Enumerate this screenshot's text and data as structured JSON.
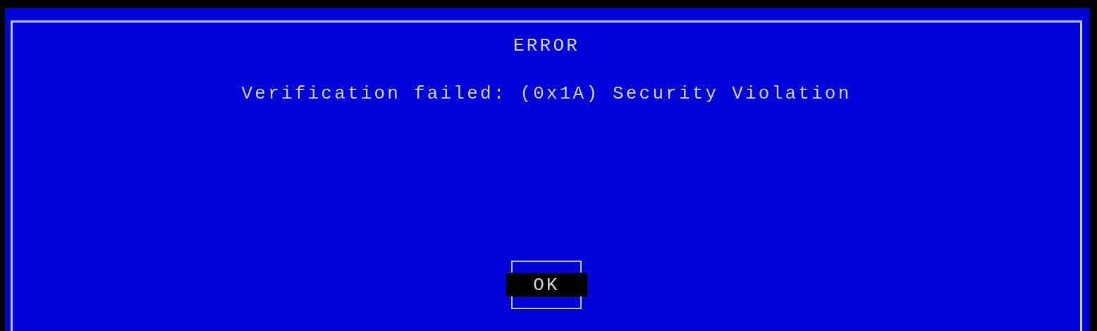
{
  "dialog": {
    "title": "ERROR",
    "message": "Verification failed: (0x1A) Security Violation",
    "buttons": [
      {
        "label": "OK",
        "selected": true
      }
    ]
  }
}
